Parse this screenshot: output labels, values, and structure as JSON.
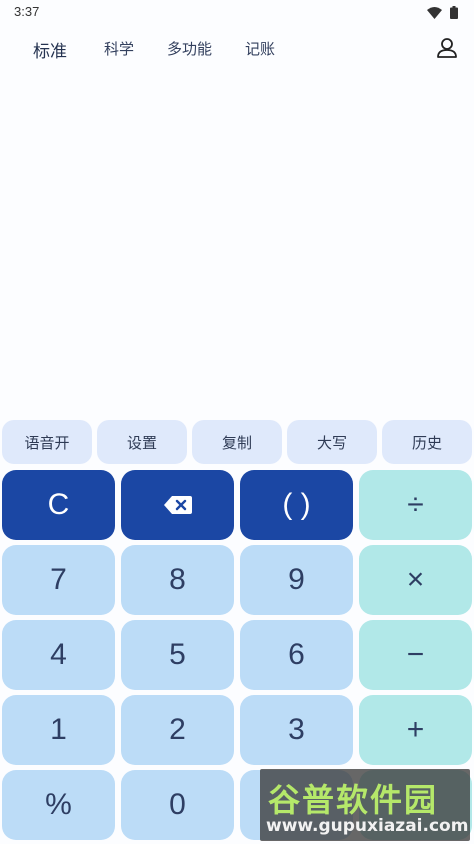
{
  "status_bar": {
    "time": "3:37",
    "icons": [
      "wifi-icon",
      "battery-icon"
    ]
  },
  "tabs": [
    {
      "label": "标准",
      "active": true
    },
    {
      "label": "科学",
      "active": false
    },
    {
      "label": "多功能",
      "active": false
    },
    {
      "label": "记账",
      "active": false
    }
  ],
  "header": {
    "user_icon": "user-icon"
  },
  "function_buttons": [
    "语音开",
    "设置",
    "复制",
    "大写",
    "历史"
  ],
  "keypad": {
    "clear": "C",
    "backspace_icon": "backspace-icon",
    "parentheses": "( )",
    "divide": "÷",
    "multiply": "×",
    "minus": "−",
    "plus": "+",
    "digits": {
      "d7": "7",
      "d8": "8",
      "d9": "9",
      "d4": "4",
      "d5": "5",
      "d6": "6",
      "d1": "1",
      "d2": "2",
      "d3": "3",
      "d0": "0"
    },
    "percent": "%"
  },
  "colors": {
    "dark_key": "#1b47a4",
    "light_key": "#bcdcf7",
    "operator_key": "#b1e8e8",
    "function_button": "#dfe9fb"
  },
  "watermark": {
    "title": "谷普软件园",
    "url": "www.gupuxiazai.com"
  }
}
